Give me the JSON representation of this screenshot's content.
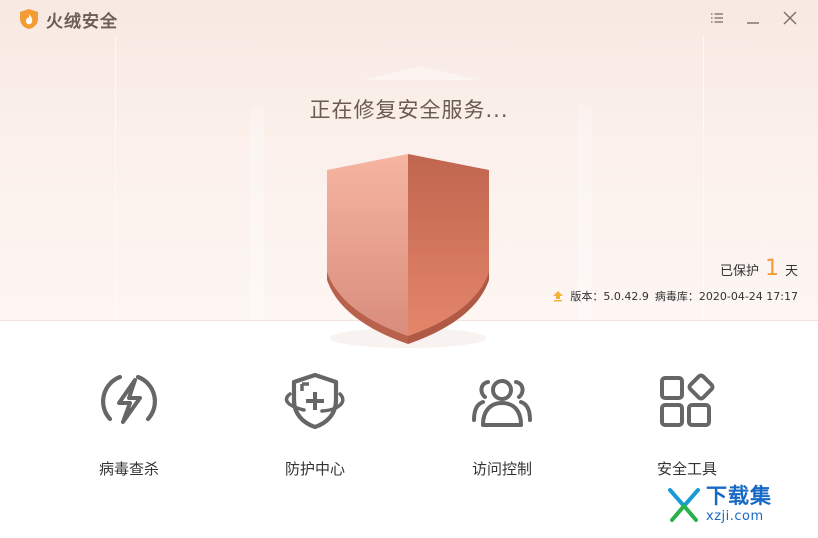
{
  "app": {
    "title": "火绒安全"
  },
  "window_controls": {
    "menu_icon": "menu-icon",
    "minimize_icon": "minimize-icon",
    "close_icon": "close-icon"
  },
  "status": {
    "message": "正在修复安全服务..."
  },
  "protection": {
    "prefix": "已保护",
    "days": "1",
    "suffix": "天"
  },
  "version": {
    "version_label": "版本：",
    "version_value": "5.0.42.9",
    "db_label": "病毒库：",
    "db_value": "2020-04-24 17:17"
  },
  "features": [
    {
      "label": "病毒查杀",
      "icon": "lightning-circle-icon"
    },
    {
      "label": "防护中心",
      "icon": "shield-orbit-icon"
    },
    {
      "label": "访问控制",
      "icon": "users-icon"
    },
    {
      "label": "安全工具",
      "icon": "apps-grid-icon"
    }
  ],
  "watermark": {
    "main": "下载集",
    "sub": "xzji.com"
  },
  "colors": {
    "accent": "#f39b34",
    "shield_light": "#f3a995",
    "shield_dark": "#c86a55",
    "icon_gray": "#666666"
  }
}
